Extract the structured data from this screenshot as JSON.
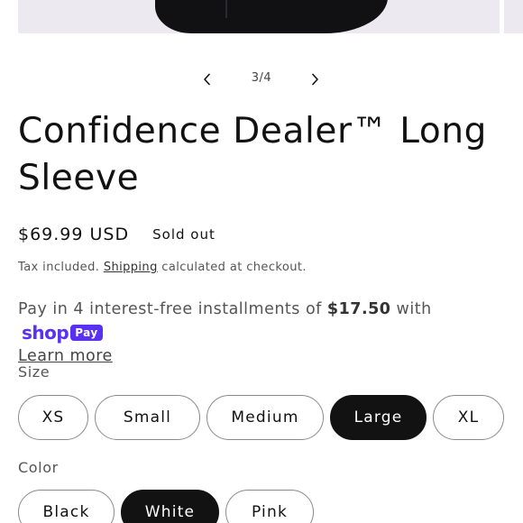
{
  "gallery": {
    "current": "3/4",
    "prev_icon": "chevron-left-icon",
    "next_icon": "chevron-right-icon"
  },
  "product": {
    "title": "Confidence Dealer™ Long Sleeve",
    "price": "$69.99 USD",
    "availability": "Sold out"
  },
  "tax": {
    "prefix": "Tax included.",
    "link": "Shipping",
    "suffix": "calculated at checkout."
  },
  "installments": {
    "prefix": "Pay in 4 interest-free installments of",
    "amount": "$17.50",
    "suffix": "with",
    "shop_word": "shop",
    "pay_badge": "Pay",
    "learn_more": "Learn more",
    "brand_color": "#5a31f4"
  },
  "size": {
    "label": "Size",
    "options": [
      "XS",
      "Small",
      "Medium",
      "Large",
      "XL"
    ],
    "selected": "Large"
  },
  "color": {
    "label": "Color",
    "options": [
      "Black",
      "White",
      "Pink"
    ],
    "selected": "White"
  }
}
